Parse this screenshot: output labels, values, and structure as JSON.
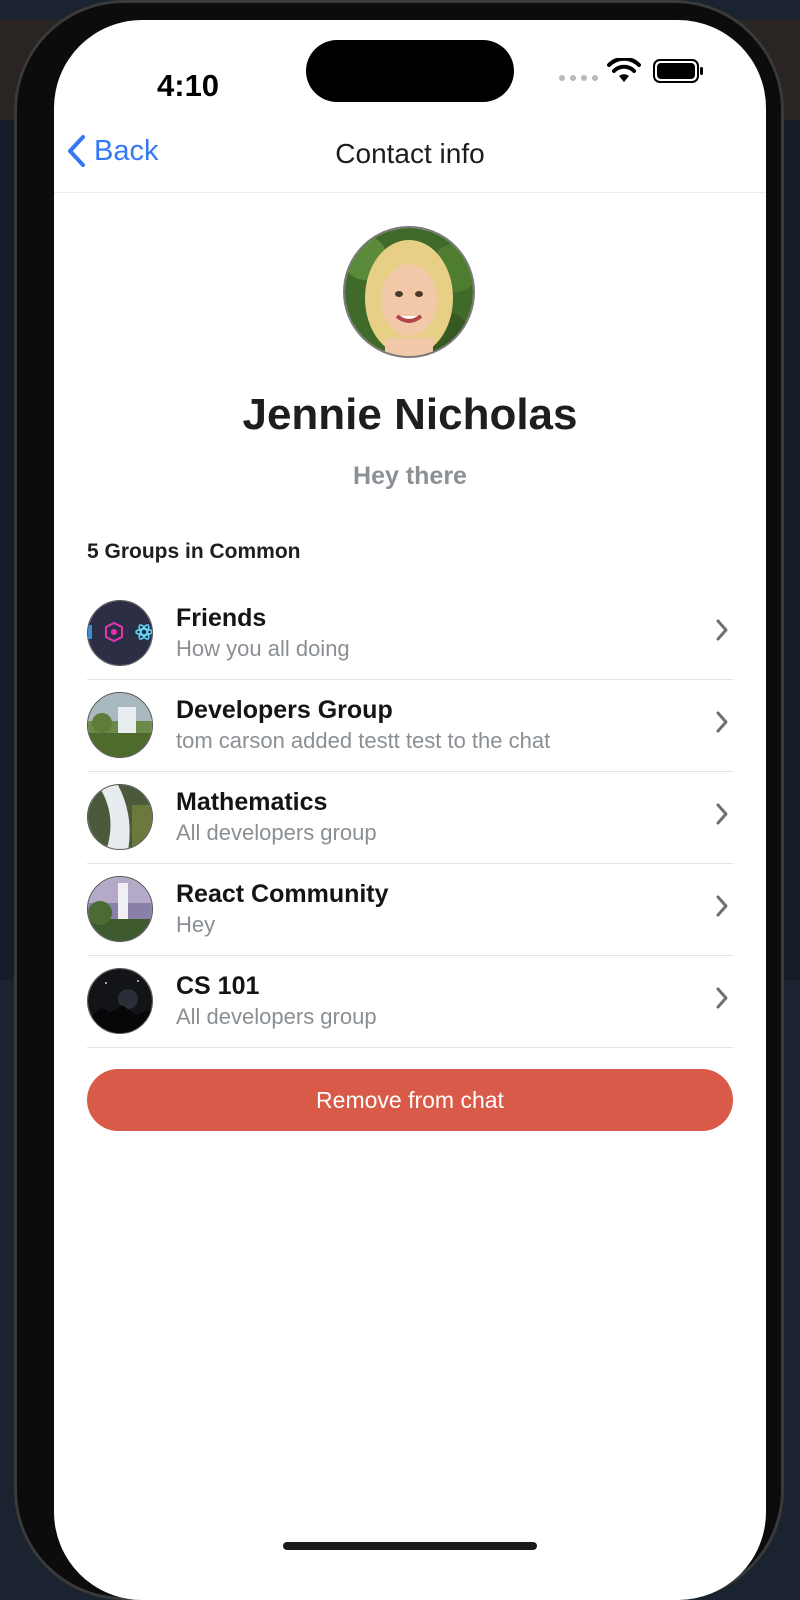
{
  "status_bar": {
    "time": "4:10"
  },
  "nav": {
    "back_label": "Back",
    "title": "Contact info"
  },
  "profile": {
    "name": "Jennie Nicholas",
    "status": "Hey there"
  },
  "groups": {
    "header": "5 Groups in Common",
    "items": [
      {
        "name": "Friends",
        "subtitle": "How you all doing"
      },
      {
        "name": "Developers Group",
        "subtitle": "tom carson added testt test to the chat"
      },
      {
        "name": "Mathematics",
        "subtitle": "All developers group"
      },
      {
        "name": "React Community",
        "subtitle": "Hey"
      },
      {
        "name": "CS 101",
        "subtitle": "All developers group"
      }
    ]
  },
  "actions": {
    "remove_label": "Remove from chat"
  },
  "colors": {
    "accent": "#3478f6",
    "danger": "#d95a48"
  }
}
